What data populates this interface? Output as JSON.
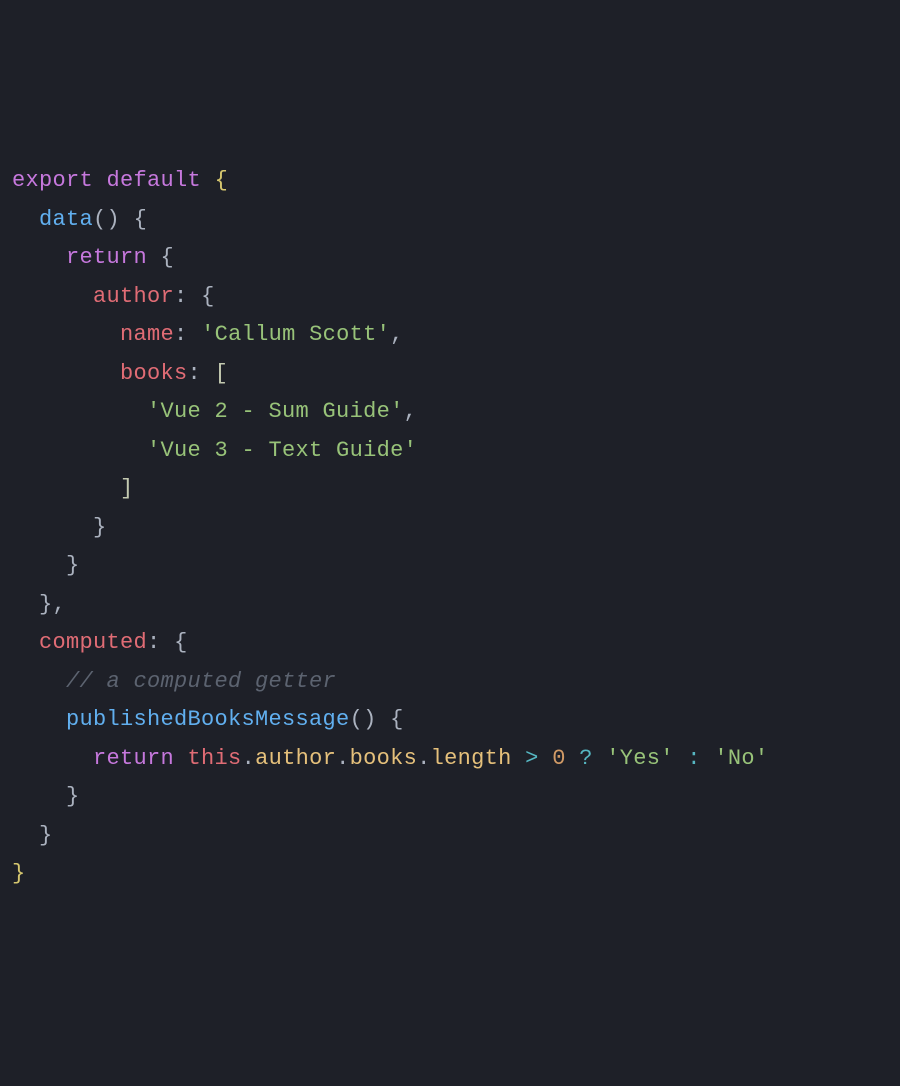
{
  "code": {
    "tokens": {
      "export": "export",
      "default": "default",
      "data": "data",
      "return": "return",
      "author": "author",
      "name": "name",
      "name_value": "'Callum Scott'",
      "books": "books",
      "book1": "'Vue 2 - Sum Guide'",
      "book2": "'Vue 3 - Text Guide'",
      "computed": "computed",
      "comment": "// a computed getter",
      "publishedBooksMessage": "publishedBooksMessage",
      "this": "this",
      "length": "length",
      "zero": "0",
      "yes": "'Yes'",
      "no": "'No'",
      "gt": ">",
      "qmark": "?",
      "ternary_colon": ":"
    }
  }
}
